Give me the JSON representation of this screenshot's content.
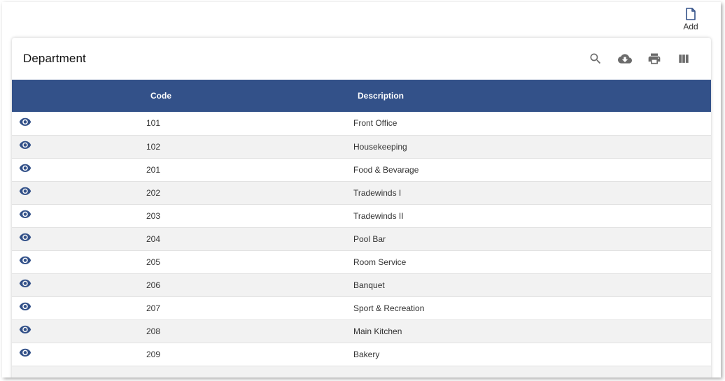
{
  "toolbar_top": {
    "add_label": "Add"
  },
  "card": {
    "title": "Department"
  },
  "table": {
    "columns": {
      "code": "Code",
      "description": "Description"
    },
    "rows": [
      {
        "code": "101",
        "description": "Front Office"
      },
      {
        "code": "102",
        "description": "Housekeeping"
      },
      {
        "code": "201",
        "description": "Food & Bevarage"
      },
      {
        "code": "202",
        "description": "Tradewinds I"
      },
      {
        "code": "203",
        "description": "Tradewinds II"
      },
      {
        "code": "204",
        "description": "Pool Bar"
      },
      {
        "code": "205",
        "description": "Room Service"
      },
      {
        "code": "206",
        "description": "Banquet"
      },
      {
        "code": "207",
        "description": "Sport & Recreation"
      },
      {
        "code": "208",
        "description": "Main Kitchen"
      },
      {
        "code": "209",
        "description": "Bakery"
      },
      {
        "code": "",
        "description": ""
      }
    ]
  },
  "icons": {
    "add": "file-icon",
    "search": "search-icon",
    "download": "cloud-download-icon",
    "print": "print-icon",
    "columns": "view-column-icon",
    "view": "eye-icon"
  },
  "colors": {
    "header_bg": "#335189",
    "icon_gray": "#6b6b6b",
    "eye": "#335189"
  }
}
